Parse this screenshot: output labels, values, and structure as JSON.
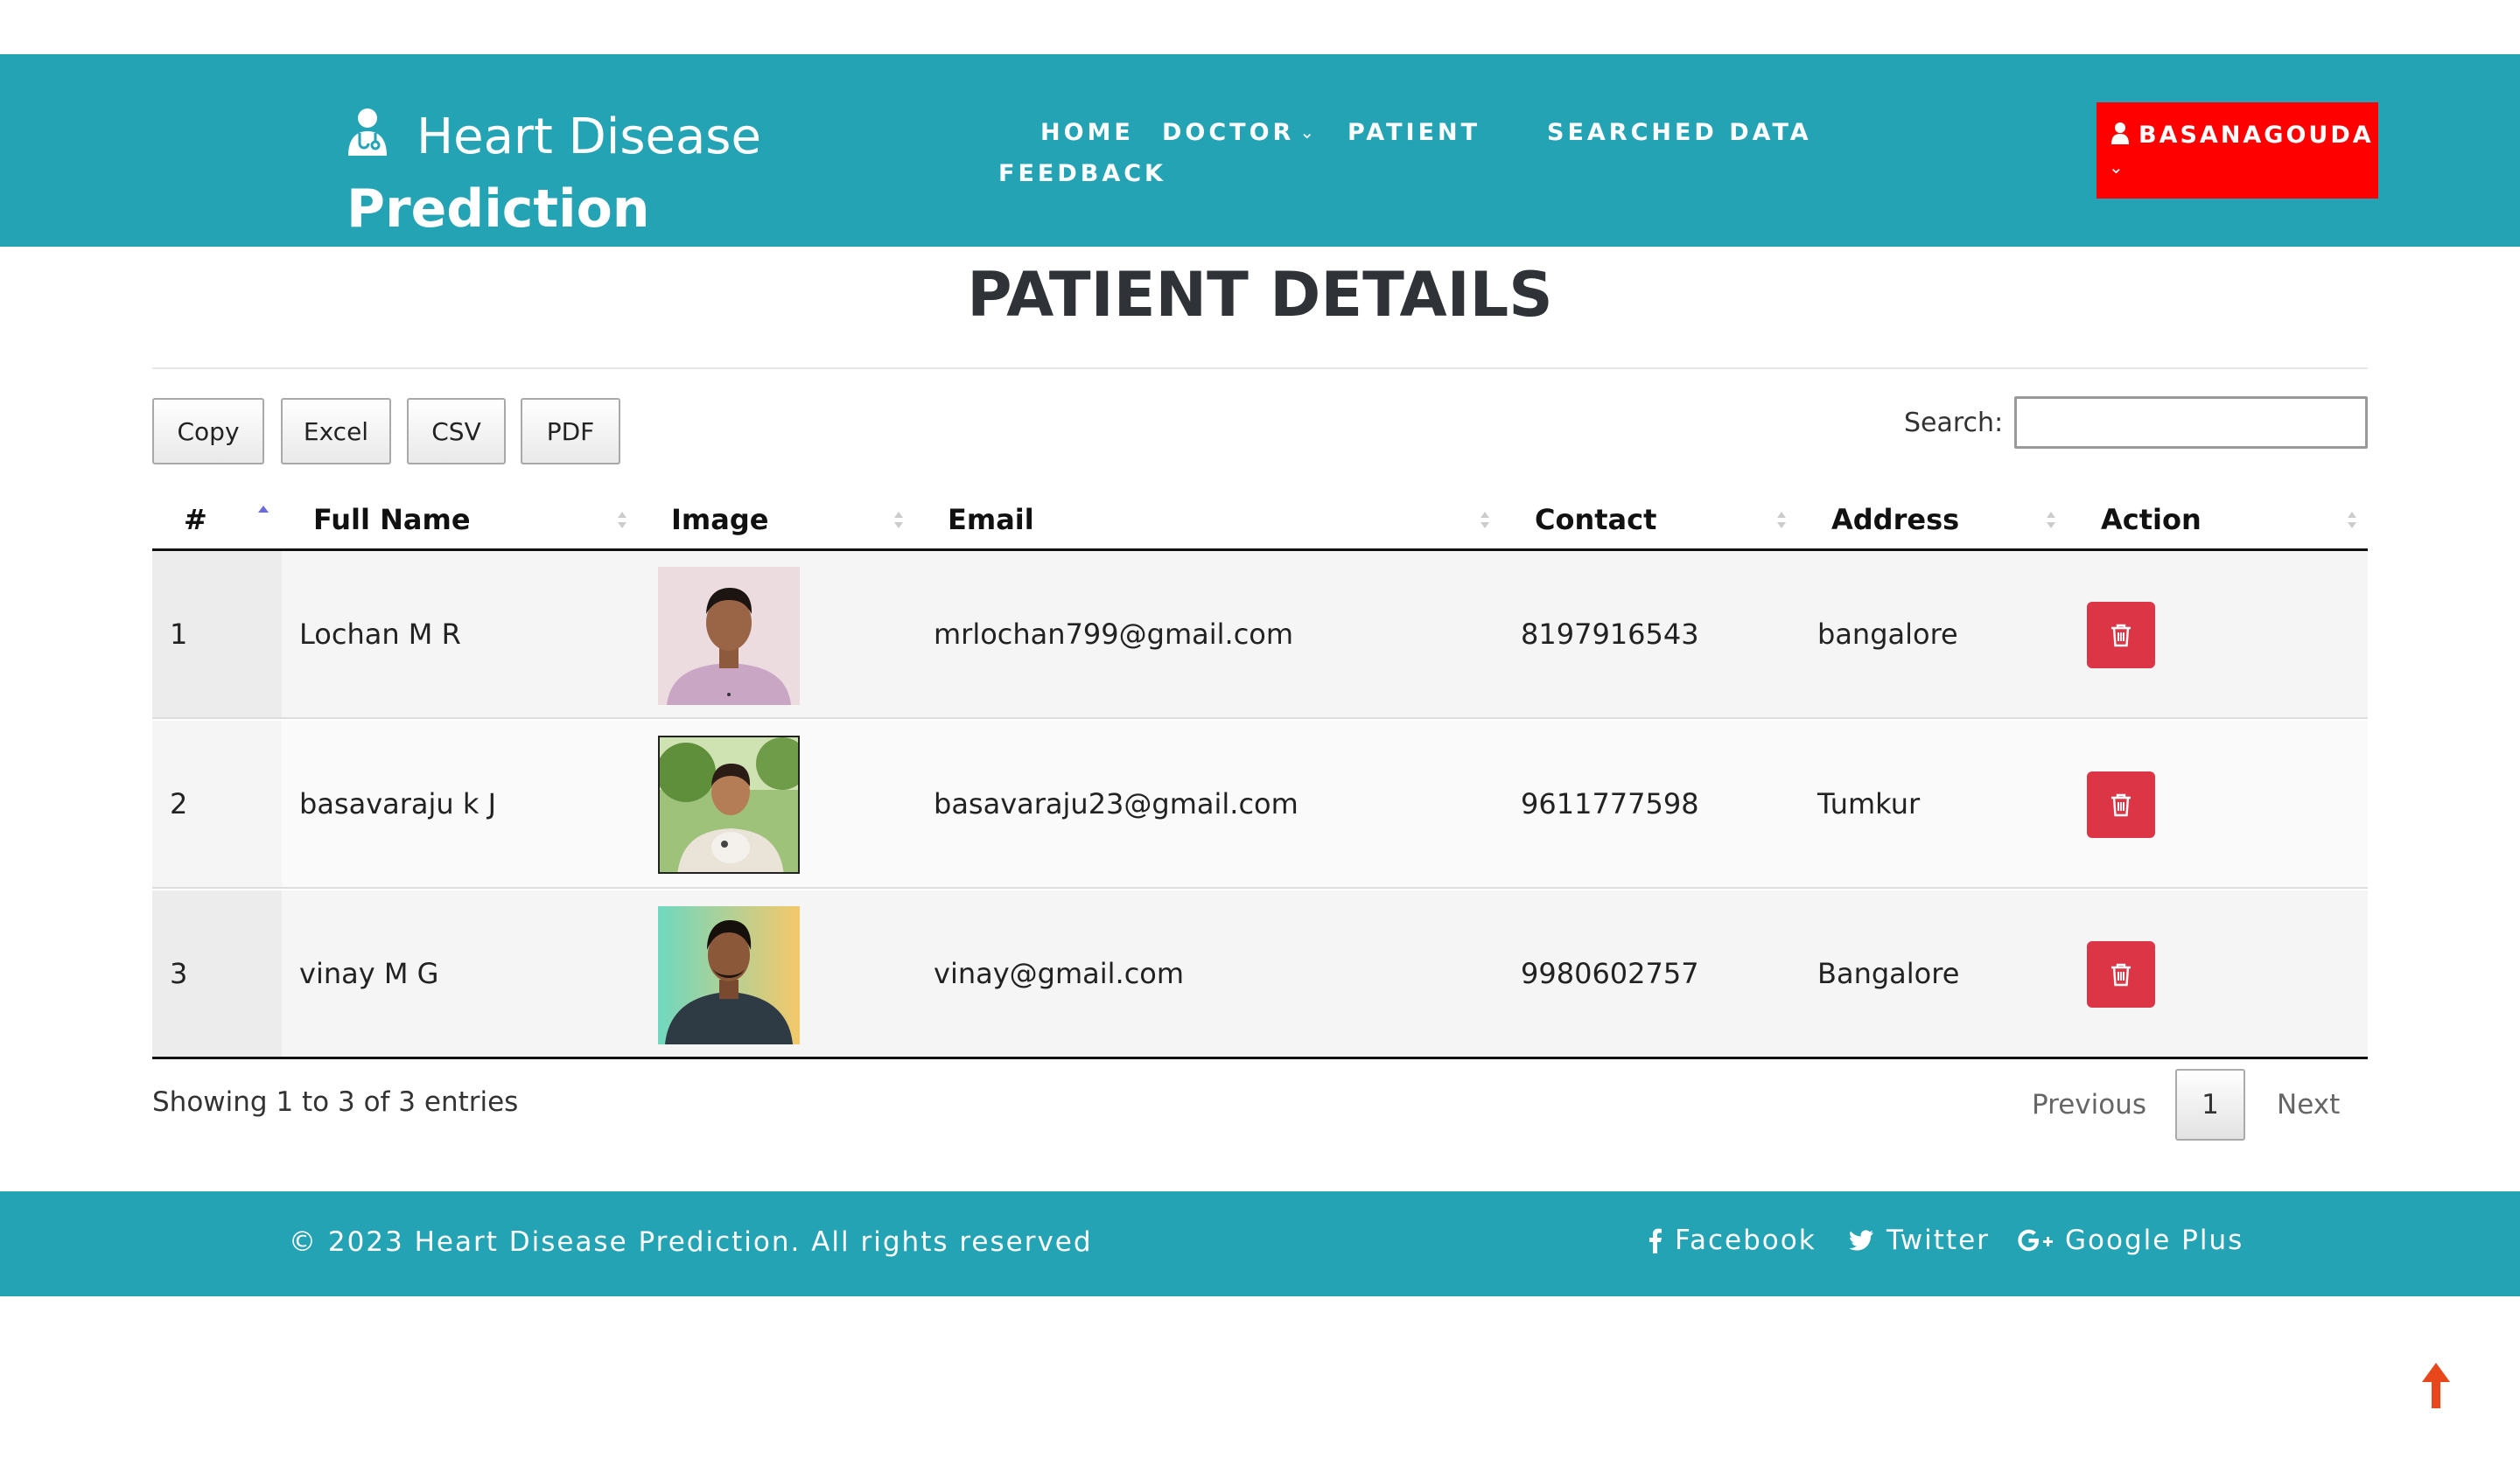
{
  "brand": {
    "line1": "Heart Disease",
    "line2": "Prediction"
  },
  "nav": {
    "home": "HOME",
    "doctor": "DOCTOR",
    "patient": "PATIENT",
    "searched_data": "SEARCHED DATA",
    "feedback": "FEEDBACK"
  },
  "user": {
    "name": "BASANAGOUDA",
    "color": "#ff0000"
  },
  "page": {
    "title": "PATIENT DETAILS"
  },
  "export_buttons": {
    "copy": "Copy",
    "excel": "Excel",
    "csv": "CSV",
    "pdf": "PDF"
  },
  "search": {
    "label": "Search:",
    "value": ""
  },
  "table": {
    "columns": {
      "num": "#",
      "full_name": "Full Name",
      "image": "Image",
      "email": "Email",
      "contact": "Contact",
      "address": "Address",
      "action": "Action"
    },
    "rows": [
      {
        "num": "1",
        "full_name": "Lochan M R",
        "email": "mrlochan799@gmail.com",
        "contact": "8197916543",
        "address": "bangalore"
      },
      {
        "num": "2",
        "full_name": "basavaraju k J",
        "email": "basavaraju23@gmail.com",
        "contact": "9611777598",
        "address": "Tumkur"
      },
      {
        "num": "3",
        "full_name": "vinay M G",
        "email": "vinay@gmail.com",
        "contact": "9980602757",
        "address": "Bangalore"
      }
    ]
  },
  "pagination": {
    "info": "Showing 1 to 3 of 3 entries",
    "previous": "Previous",
    "current": "1",
    "next": "Next"
  },
  "footer": {
    "copyright": "© 2023 Heart Disease Prediction. All rights reserved",
    "facebook": "Facebook",
    "twitter": "Twitter",
    "google_plus": "Google Plus"
  },
  "colors": {
    "primary": "#24a3b5",
    "danger": "#dc3545",
    "user_button": "#ff0000"
  }
}
